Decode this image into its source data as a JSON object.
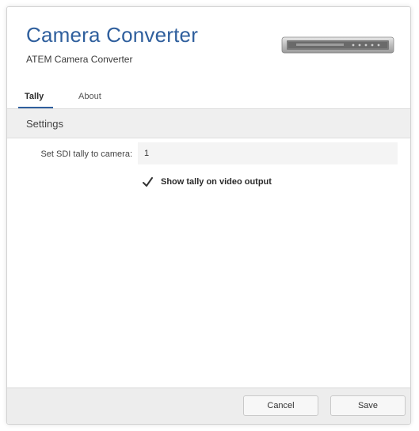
{
  "header": {
    "title": "Camera Converter",
    "subtitle": "ATEM Camera Converter",
    "device_image": "atem-camera-converter-device"
  },
  "tabs": [
    {
      "label": "Tally",
      "active": true
    },
    {
      "label": "About",
      "active": false
    }
  ],
  "settings": {
    "section_title": "Settings",
    "sdi_tally_label": "Set SDI tally to camera:",
    "sdi_tally_value": "1",
    "show_tally_label": "Show tally on video output",
    "show_tally_checked": true
  },
  "footer": {
    "cancel_label": "Cancel",
    "save_label": "Save"
  },
  "colors": {
    "accent": "#2f5f9d"
  }
}
